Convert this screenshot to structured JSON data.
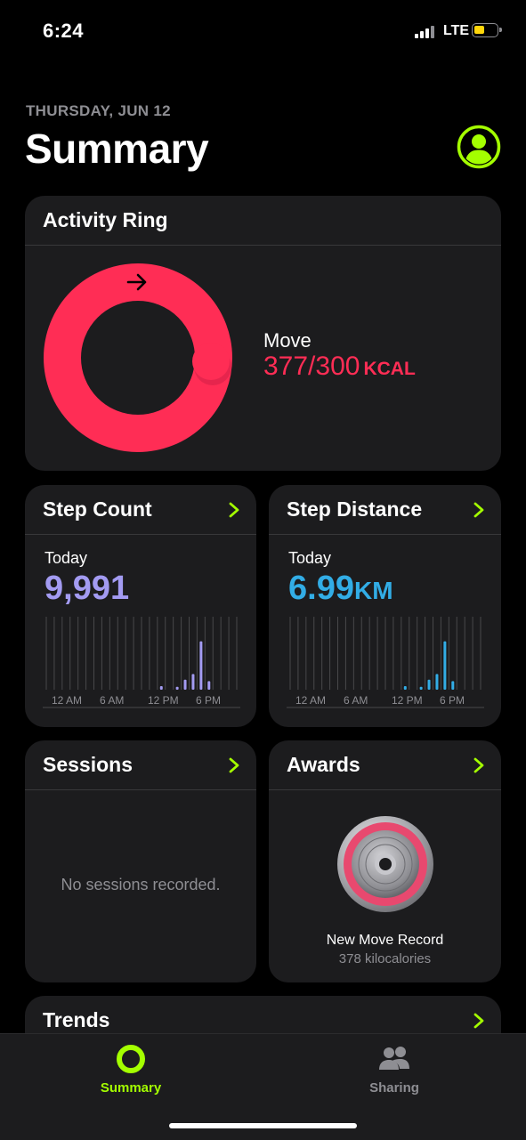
{
  "status_bar": {
    "time": "6:24",
    "network": "LTE"
  },
  "header": {
    "date": "THURSDAY, JUN 12",
    "title": "Summary"
  },
  "activity": {
    "title": "Activity Ring",
    "move_label": "Move",
    "move_value": "377/300",
    "move_unit": "KCAL",
    "move_progress": 1.257,
    "ring_color": "#ff2d55",
    "icon": "arrow-right-icon"
  },
  "step_count": {
    "title": "Step Count",
    "period": "Today",
    "value": "9,991",
    "color": "#a39bf2",
    "chart_labels": [
      "12 AM",
      "6 AM",
      "12 PM",
      "6 PM"
    ],
    "bars": [
      0,
      0,
      0,
      0,
      0,
      0,
      0,
      0,
      0,
      0,
      0,
      0,
      0,
      0,
      0.05,
      0,
      0.04,
      0.14,
      0.22,
      0.68,
      0.12,
      0,
      0,
      0
    ]
  },
  "step_distance": {
    "title": "Step Distance",
    "period": "Today",
    "value": "6.99",
    "unit": "KM",
    "color": "#32ade6",
    "chart_labels": [
      "12 AM",
      "6 AM",
      "12 PM",
      "6 PM"
    ],
    "bars": [
      0,
      0,
      0,
      0,
      0,
      0,
      0,
      0,
      0,
      0,
      0,
      0,
      0,
      0,
      0.05,
      0,
      0.04,
      0.14,
      0.22,
      0.68,
      0.12,
      0,
      0,
      0
    ]
  },
  "sessions": {
    "title": "Sessions",
    "empty": "No sessions recorded."
  },
  "awards": {
    "title": "Awards",
    "name": "New Move Record",
    "detail": "378 kilocalories"
  },
  "trends": {
    "title": "Trends"
  },
  "tab_bar": {
    "summary_label": "Summary",
    "sharing_label": "Sharing",
    "active_color": "#a4ff00",
    "inactive_color": "#8e8e93"
  }
}
